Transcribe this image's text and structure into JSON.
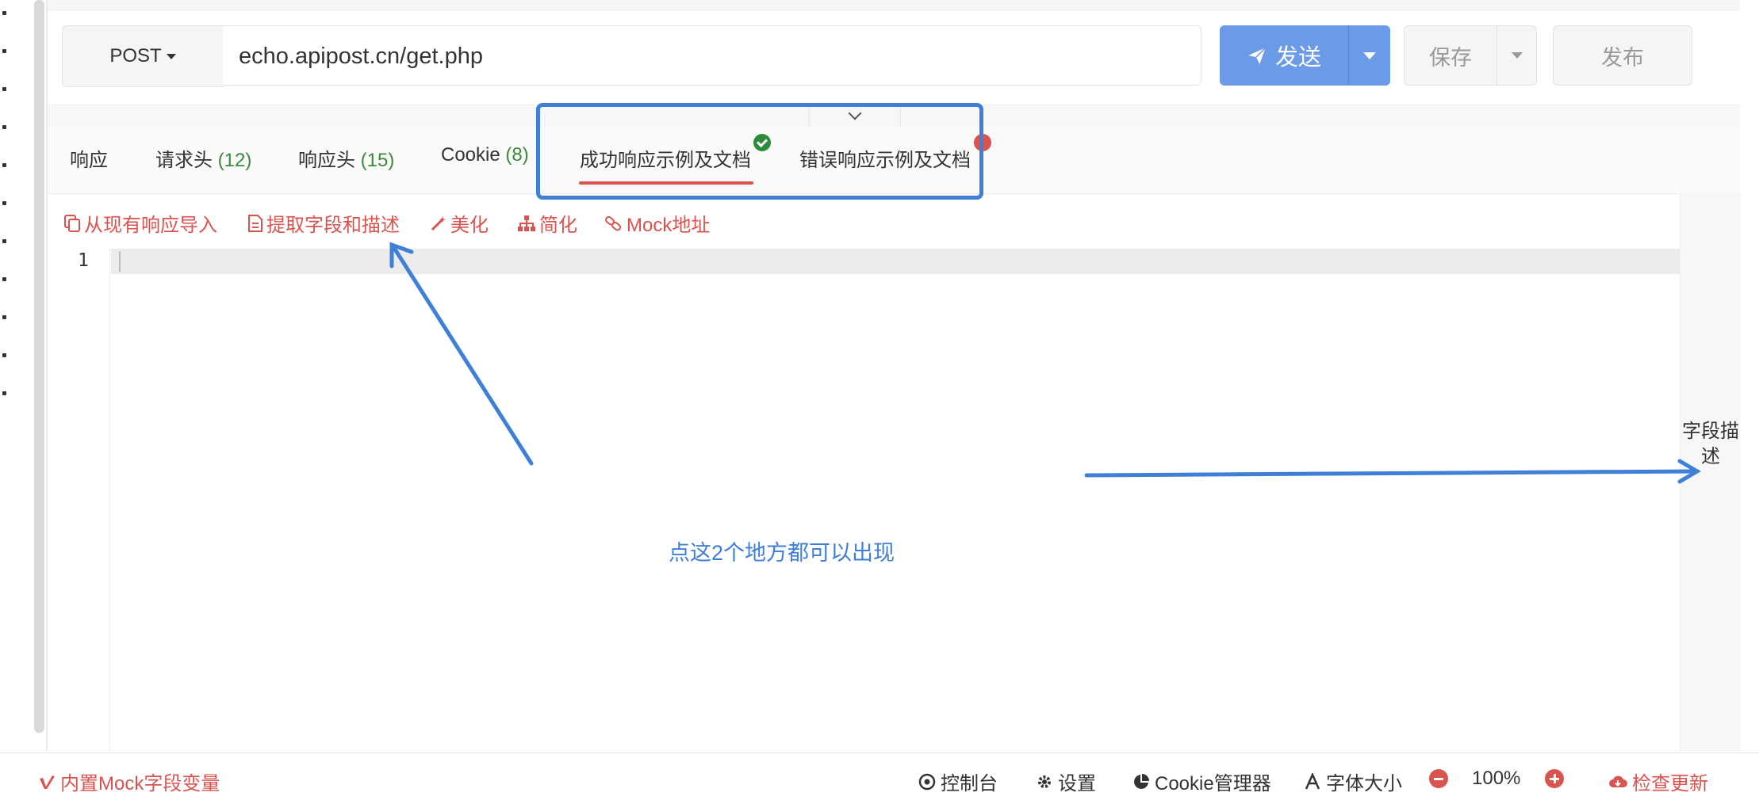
{
  "request": {
    "method": "POST",
    "url": "echo.apipost.cn/get.php",
    "send_label": "发送",
    "save_label": "保存",
    "publish_label": "发布"
  },
  "tabs": [
    {
      "label": "响应",
      "count": ""
    },
    {
      "label": "请求头",
      "count": "(12)"
    },
    {
      "label": "响应头",
      "count": "(15)"
    },
    {
      "label": "Cookie",
      "count": "(8)"
    },
    {
      "label": "成功响应示例及文档",
      "count": "",
      "active": true,
      "status": "success"
    },
    {
      "label": "错误响应示例及文档",
      "count": "",
      "status": "error"
    }
  ],
  "toolbar": {
    "import_label": "从现有响应导入",
    "extract_label": "提取字段和描述",
    "beautify_label": "美化",
    "simplify_label": "简化",
    "mock_label": "Mock地址"
  },
  "editor": {
    "line_number": "1"
  },
  "field_panel": {
    "label": "字段描述"
  },
  "annotation": {
    "note": "点这2个地方都可以出现",
    "color": "#3f7fd8"
  },
  "statusbar": {
    "mock_vars_label": "内置Mock字段变量",
    "console_label": "控制台",
    "settings_label": "设置",
    "cookie_manager_label": "Cookie管理器",
    "font_size_label": "字体大小",
    "zoom": "100%",
    "update_label": "检查更新"
  },
  "colors": {
    "primary": "#6b9ae6",
    "danger": "#d9534f",
    "success": "#2e8b3a"
  }
}
